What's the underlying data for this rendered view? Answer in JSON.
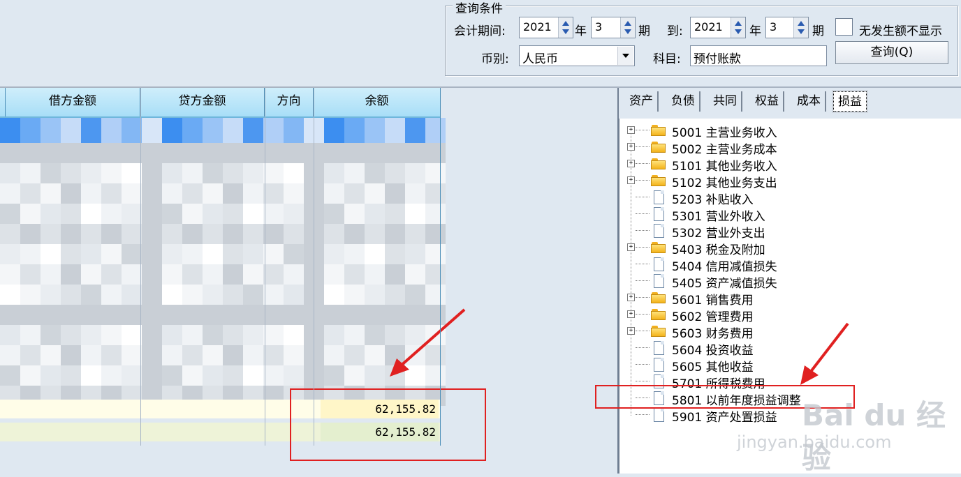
{
  "query": {
    "group_title": "查询条件",
    "period_label": "会计期间:",
    "from_year": "2021",
    "year_unit": "年",
    "from_period": "3",
    "period_unit": "期",
    "to_label": "到:",
    "to_year": "2021",
    "to_period": "3",
    "hide_zero_label": "无发生额不显示",
    "currency_label": "币别:",
    "currency_value": "人民币",
    "account_label": "科目:",
    "account_value": "预付账款",
    "query_button": "查询(Q)"
  },
  "table": {
    "headers": [
      "借方金额",
      "贷方金额",
      "方向",
      "余额"
    ],
    "balances": [
      "62,155.82",
      "62,155.82"
    ]
  },
  "tabs": [
    "资产",
    "负债",
    "共同",
    "权益",
    "成本",
    "损益"
  ],
  "active_tab": "损益",
  "tree": [
    {
      "code": "5001",
      "name": "主营业务收入",
      "type": "folder"
    },
    {
      "code": "5002",
      "name": "主营业务成本",
      "type": "folder"
    },
    {
      "code": "5101",
      "name": "其他业务收入",
      "type": "folder"
    },
    {
      "code": "5102",
      "name": "其他业务支出",
      "type": "folder"
    },
    {
      "code": "5203",
      "name": "补贴收入",
      "type": "doc"
    },
    {
      "code": "5301",
      "name": "营业外收入",
      "type": "doc"
    },
    {
      "code": "5302",
      "name": "营业外支出",
      "type": "doc"
    },
    {
      "code": "5403",
      "name": "税金及附加",
      "type": "folder"
    },
    {
      "code": "5404",
      "name": "信用减值损失",
      "type": "doc"
    },
    {
      "code": "5405",
      "name": "资产减值损失",
      "type": "doc"
    },
    {
      "code": "5601",
      "name": "销售费用",
      "type": "folder"
    },
    {
      "code": "5602",
      "name": "管理费用",
      "type": "folder"
    },
    {
      "code": "5603",
      "name": "财务费用",
      "type": "folder"
    },
    {
      "code": "5604",
      "name": "投资收益",
      "type": "doc"
    },
    {
      "code": "5605",
      "name": "其他收益",
      "type": "doc"
    },
    {
      "code": "5701",
      "name": "所得税费用",
      "type": "doc"
    },
    {
      "code": "5801",
      "name": "以前年度损益调整",
      "type": "doc"
    },
    {
      "code": "5901",
      "name": "资产处置损益",
      "type": "doc"
    }
  ],
  "watermark": {
    "brand": "Bai du 经验",
    "url": "jingyan.baidu.com"
  },
  "colors": {
    "annotation_red": "#e02020",
    "header_blue": "#a8def7",
    "highlight_yellow": "#fff8c8"
  }
}
